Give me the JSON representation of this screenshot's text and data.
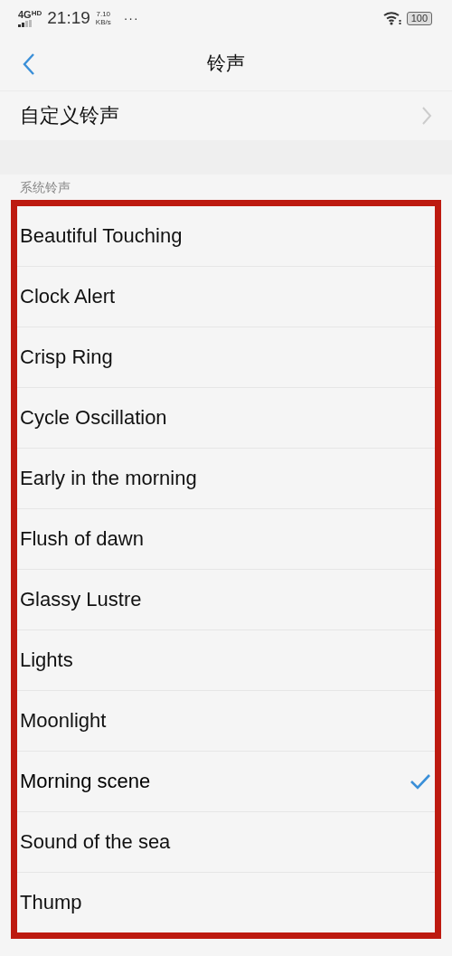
{
  "status_bar": {
    "network": "4G",
    "network_badge": "HD",
    "time": "21:19",
    "speed": "7.10",
    "speed_unit": "KB/s",
    "more": "···",
    "battery": "100"
  },
  "header": {
    "title": "铃声"
  },
  "custom_item": {
    "label": "自定义铃声"
  },
  "section": {
    "title": "系统铃声",
    "highlighted": true
  },
  "ringtones": [
    {
      "name": "Beautiful Touching",
      "selected": false
    },
    {
      "name": "Clock Alert",
      "selected": false
    },
    {
      "name": "Crisp Ring",
      "selected": false
    },
    {
      "name": "Cycle Oscillation",
      "selected": false
    },
    {
      "name": "Early in the morning",
      "selected": false
    },
    {
      "name": "Flush of dawn",
      "selected": false
    },
    {
      "name": "Glassy Lustre",
      "selected": false
    },
    {
      "name": "Lights",
      "selected": false
    },
    {
      "name": "Moonlight",
      "selected": false
    },
    {
      "name": "Morning scene",
      "selected": true
    },
    {
      "name": "Sound of the sea",
      "selected": false
    },
    {
      "name": "Thump",
      "selected": false
    }
  ]
}
